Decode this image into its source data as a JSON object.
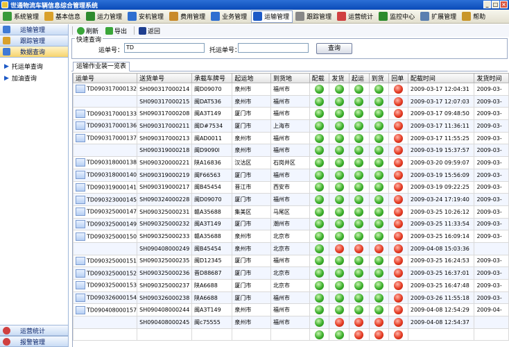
{
  "window": {
    "title": "世通物流车辆信息综合管理系统",
    "controls": [
      "_",
      "□",
      "×"
    ]
  },
  "menu": [
    {
      "label": "系统管理",
      "icon": "system-icon",
      "color": "#3a9a3a"
    },
    {
      "label": "基本信息",
      "icon": "info-icon",
      "color": "#d9a12b"
    },
    {
      "label": "运力管理",
      "icon": "truck-icon",
      "color": "#2e8b2e"
    },
    {
      "label": "安机管理",
      "icon": "globe-icon",
      "color": "#2f6fd0"
    },
    {
      "label": "费用管理",
      "icon": "money-icon",
      "color": "#c98a2a"
    },
    {
      "label": "业务管理",
      "icon": "cart-icon",
      "color": "#2f6fd0"
    },
    {
      "label": "运输管理",
      "icon": "transport-icon",
      "color": "#1d59c6",
      "active": true
    },
    {
      "label": "跟踪管理",
      "icon": "track-icon",
      "color": "#888888"
    },
    {
      "label": "运营统计",
      "icon": "chart-icon",
      "color": "#d04040"
    },
    {
      "label": "监控中心",
      "icon": "monitor-icon",
      "color": "#2e8b2e"
    },
    {
      "label": "扩展管理",
      "icon": "extend-icon",
      "color": "#5a7fb0"
    },
    {
      "label": "帮助",
      "icon": "help-icon",
      "color": "#c9962a"
    }
  ],
  "sidebar": {
    "sections": [
      {
        "label": "运输管理",
        "icon": "transport-icon",
        "color": "#3f7ad6",
        "selected": false
      },
      {
        "label": "跟踪管理",
        "icon": "track-icon",
        "color": "#d9a12b",
        "selected": false
      },
      {
        "label": "数据查询",
        "icon": "query-icon",
        "color": "#3f7ad6",
        "selected": true
      }
    ],
    "links": [
      "托运单查询",
      "加油查询"
    ],
    "bottom": [
      {
        "label": "运营统计",
        "icon": "chart-icon",
        "color": "#d04040"
      },
      {
        "label": "报警管理",
        "icon": "alarm-icon",
        "color": "#d04040"
      }
    ]
  },
  "toolbar": {
    "refresh": "刷新",
    "export": "导出",
    "back": "返回"
  },
  "query": {
    "legend": "快速查询",
    "waybill_label": "运单号：",
    "waybill_value": "TD",
    "consign_label": "托运单号：",
    "consign_value": "",
    "search_button": "查询"
  },
  "tab": "运输作业装一览表",
  "table": {
    "headers": [
      "运单号",
      "送货单号",
      "承载车牌号",
      "起运地",
      "到货地",
      "配载",
      "发货",
      "起运",
      "到货",
      "回单",
      "配载时间",
      "发货时间"
    ],
    "rows": [
      {
        "waybill": "TD090317000132",
        "delivery": "SH090317000214",
        "plate": "闽D09070",
        "from": "泉州市",
        "to": "福州市",
        "s": [
          "g",
          "g",
          "g",
          "g",
          "r"
        ],
        "time": "2009-03-17 12:04:31",
        "ship": "2009-03-"
      },
      {
        "waybill": "",
        "delivery": "SH090317000215",
        "plate": "闽DAT536",
        "from": "泉州市",
        "to": "福州市",
        "s": [
          "g",
          "g",
          "g",
          "g",
          "r"
        ],
        "time": "2009-03-17 12:07:03",
        "ship": "2009-03-"
      },
      {
        "waybill": "TD090317000133",
        "delivery": "SH090317000208",
        "plate": "闽A3T149",
        "from": "厦门市",
        "to": "福州市",
        "s": [
          "g",
          "g",
          "g",
          "g",
          "r"
        ],
        "time": "2009-03-17 09:48:50",
        "ship": "2009-03-"
      },
      {
        "waybill": "TD090317000136",
        "delivery": "SH090317000211",
        "plate": "闽D#7534",
        "from": "厦门市",
        "to": "上海市",
        "s": [
          "g",
          "g",
          "g",
          "g",
          "r"
        ],
        "time": "2009-03-17 11:36:11",
        "ship": "2009-03-"
      },
      {
        "waybill": "TD090317000137",
        "delivery": "SH090317000213",
        "plate": "闽AD0011",
        "from": "泉州市",
        "to": "福州市",
        "s": [
          "g",
          "g",
          "g",
          "g",
          "r"
        ],
        "time": "2009-03-17 11:55:25",
        "ship": "2009-03-"
      },
      {
        "waybill": "",
        "delivery": "SH090319000218",
        "plate": "闽D9090l",
        "from": "泉州市",
        "to": "福州市",
        "s": [
          "g",
          "g",
          "g",
          "g",
          "r"
        ],
        "time": "2009-03-19 15:37:57",
        "ship": "2009-03-"
      },
      {
        "waybill": "TD090318000138",
        "delivery": "SH090320000221",
        "plate": "陕A16836",
        "from": "汉沽区",
        "to": "石岗井区",
        "s": [
          "g",
          "g",
          "g",
          "g",
          "r"
        ],
        "time": "2009-03-20 09:59:07",
        "ship": "2009-03-"
      },
      {
        "waybill": "TD090318000140",
        "delivery": "SH090319000219",
        "plate": "闽F66563",
        "from": "厦门市",
        "to": "福州市",
        "s": [
          "g",
          "g",
          "g",
          "g",
          "r"
        ],
        "time": "2009-03-19 15:56:09",
        "ship": "2009-03-"
      },
      {
        "waybill": "TD090319000141",
        "delivery": "SH090319000217",
        "plate": "闽B45454",
        "from": "晋江市",
        "to": "西安市",
        "s": [
          "g",
          "g",
          "g",
          "g",
          "r"
        ],
        "time": "2009-03-19 09:22:25",
        "ship": "2009-03-"
      },
      {
        "waybill": "TD090323000145",
        "delivery": "SH090324000228",
        "plate": "闽D09070",
        "from": "厦门市",
        "to": "福州市",
        "s": [
          "g",
          "g",
          "g",
          "g",
          "r"
        ],
        "time": "2009-03-24 17:19:40",
        "ship": "2009-03-"
      },
      {
        "waybill": "TD090325000147",
        "delivery": "SH090325000231",
        "plate": "赣A35688",
        "from": "集美区",
        "to": "马尾区",
        "s": [
          "g",
          "g",
          "g",
          "g",
          "r"
        ],
        "time": "2009-03-25 10:26:12",
        "ship": "2009-03-"
      },
      {
        "waybill": "TD090325000149",
        "delivery": "SH090325000232",
        "plate": "闽A3T149",
        "from": "厦门市",
        "to": "潮州市",
        "s": [
          "g",
          "g",
          "g",
          "g",
          "r"
        ],
        "time": "2009-03-25 11:33:54",
        "ship": "2009-03-"
      },
      {
        "waybill": "TD090325000150",
        "delivery": "SH090325000233",
        "plate": "赣A35688",
        "from": "泉州市",
        "to": "北京市",
        "s": [
          "g",
          "g",
          "g",
          "g",
          "r"
        ],
        "time": "2009-03-25 16:09:14",
        "ship": "2009-03-"
      },
      {
        "waybill": "",
        "delivery": "SH090408000249",
        "plate": "闽B45454",
        "from": "泉州市",
        "to": "北京市",
        "s": [
          "g",
          "r",
          "r",
          "r",
          "r"
        ],
        "time": "2009-04-08 15:03:36",
        "ship": ""
      },
      {
        "waybill": "TD090325000151",
        "delivery": "SH090325000235",
        "plate": "闽D12345",
        "from": "厦门市",
        "to": "福州市",
        "s": [
          "g",
          "g",
          "g",
          "g",
          "r"
        ],
        "time": "2009-03-25 16:24:53",
        "ship": "2009-03-"
      },
      {
        "waybill": "TD090325000152",
        "delivery": "SH090325000236",
        "plate": "晋D88687",
        "from": "厦门市",
        "to": "北京市",
        "s": [
          "g",
          "g",
          "g",
          "g",
          "r"
        ],
        "time": "2009-03-25 16:37:01",
        "ship": "2009-03-"
      },
      {
        "waybill": "TD090325000153",
        "delivery": "SH090325000237",
        "plate": "陕A6688",
        "from": "厦门市",
        "to": "北京市",
        "s": [
          "g",
          "g",
          "g",
          "g",
          "r"
        ],
        "time": "2009-03-25 16:47:48",
        "ship": "2009-03-"
      },
      {
        "waybill": "TD090326000154",
        "delivery": "SH090326000238",
        "plate": "陕A6688",
        "from": "厦门市",
        "to": "福州市",
        "s": [
          "g",
          "g",
          "g",
          "g",
          "r"
        ],
        "time": "2009-03-26 11:55:18",
        "ship": "2009-03-"
      },
      {
        "waybill": "TD090408000157",
        "delivery": "SH090408000244",
        "plate": "闽A3T149",
        "from": "泉州市",
        "to": "福州市",
        "s": [
          "g",
          "g",
          "g",
          "g",
          "r"
        ],
        "time": "2009-04-08 12:54:29",
        "ship": "2009-04-"
      },
      {
        "waybill": "",
        "delivery": "SH090408000245",
        "plate": "闽c75555",
        "from": "泉州市",
        "to": "福州市",
        "s": [
          "g",
          "r",
          "r",
          "r",
          "r"
        ],
        "time": "2009-04-08 12:54:37",
        "ship": ""
      },
      {
        "waybill": "",
        "delivery": "",
        "plate": "",
        "from": "",
        "to": "",
        "s": [
          "g",
          "g",
          "r",
          "r",
          "r"
        ],
        "time": "",
        "ship": ""
      }
    ]
  }
}
